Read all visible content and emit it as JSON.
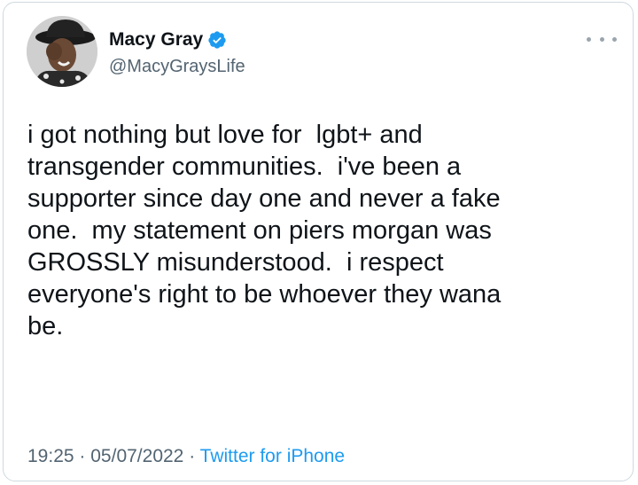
{
  "tweet": {
    "author": {
      "display_name": "Macy Gray",
      "handle": "@MacyGraysLife",
      "verified": true,
      "avatar_icon": "profile-photo"
    },
    "more_icon": "more-options-icon",
    "text": "i got nothing but love for  lgbt+ and\ntransgender communities.  i've been a\nsupporter since day one and never a fake\none.  my statement on piers morgan was\nGROSSLY misunderstood.  i respect\neveryone's right to be whoever they wana\nbe.",
    "time": "19:25",
    "separator": "·",
    "date": "05/07/2022",
    "source": "Twitter for iPhone"
  },
  "colors": {
    "text": "#0f1419",
    "secondary": "#536471",
    "link": "#1d9bf0",
    "verified": "#1d9bf0",
    "border": "#cfd9de"
  }
}
